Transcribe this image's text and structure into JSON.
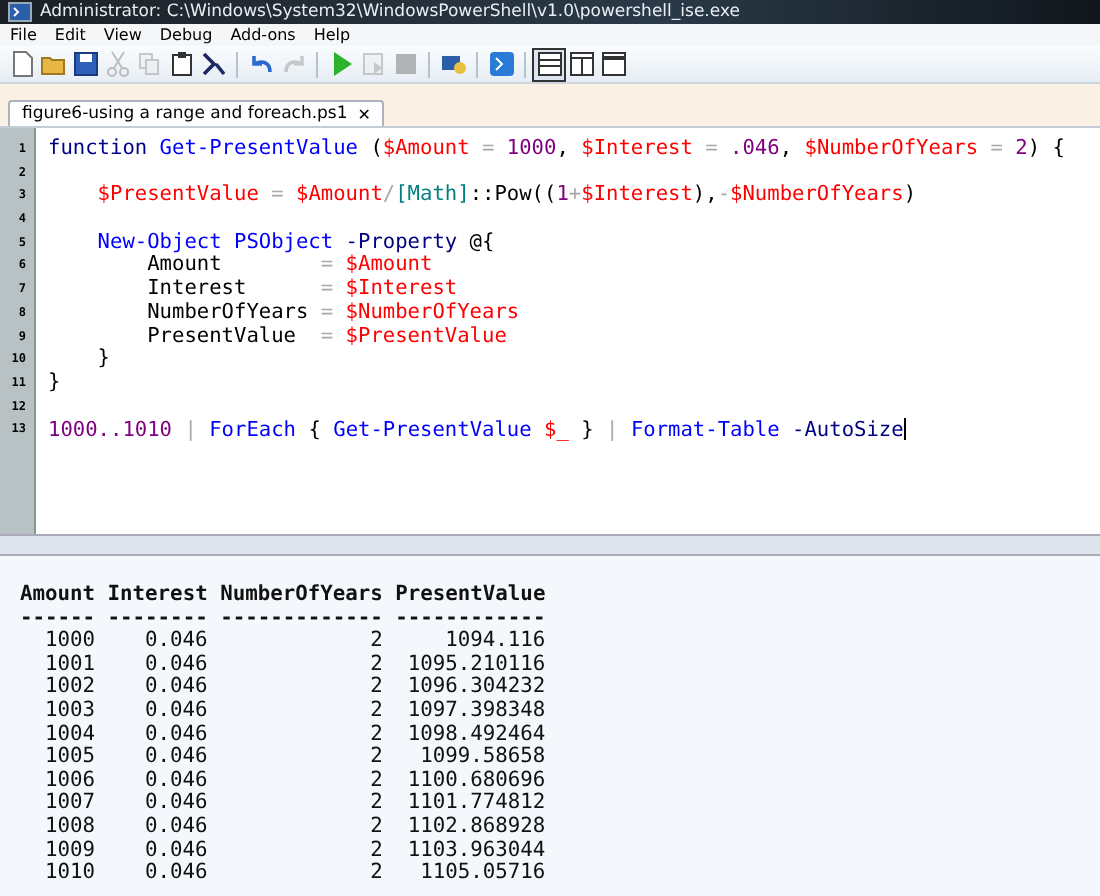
{
  "window": {
    "title": "Administrator: C:\\Windows\\System32\\WindowsPowerShell\\v1.0\\powershell_ise.exe"
  },
  "menu": [
    "File",
    "Edit",
    "View",
    "Debug",
    "Add-ons",
    "Help"
  ],
  "toolbar": [
    {
      "kind": "new",
      "disabled": false
    },
    {
      "kind": "open",
      "disabled": false
    },
    {
      "kind": "save",
      "disabled": false
    },
    {
      "kind": "cut",
      "disabled": true
    },
    {
      "kind": "copy",
      "disabled": true
    },
    {
      "kind": "paste",
      "disabled": false
    },
    {
      "kind": "console",
      "disabled": false
    },
    {
      "kind": "sep"
    },
    {
      "kind": "undo",
      "disabled": false
    },
    {
      "kind": "redo",
      "disabled": true
    },
    {
      "kind": "sep"
    },
    {
      "kind": "run",
      "disabled": false
    },
    {
      "kind": "runsel",
      "disabled": true
    },
    {
      "kind": "stop",
      "disabled": true
    },
    {
      "kind": "sep"
    },
    {
      "kind": "remote",
      "disabled": false
    },
    {
      "kind": "sep"
    },
    {
      "kind": "powershell",
      "disabled": false
    },
    {
      "kind": "sep"
    },
    {
      "kind": "layout-top",
      "selected": true
    },
    {
      "kind": "layout-right",
      "selected": false
    },
    {
      "kind": "layout-max",
      "selected": false
    }
  ],
  "tabs": [
    {
      "label": "figure6-using a range and foreach.ps1",
      "close": "✕",
      "selected": true
    }
  ],
  "editor": {
    "lines": [
      {
        "number": "1",
        "tokens": [
          {
            "text": "function ",
            "kind": "keyword"
          },
          {
            "text": "Get-PresentValue ",
            "kind": "command"
          },
          {
            "text": "(",
            "kind": "plain"
          },
          {
            "text": "$Amount",
            "kind": "variable"
          },
          {
            "text": " = ",
            "kind": "operator"
          },
          {
            "text": "1000",
            "kind": "number"
          },
          {
            "text": ", ",
            "kind": "plain"
          },
          {
            "text": "$Interest",
            "kind": "variable"
          },
          {
            "text": " = ",
            "kind": "operator"
          },
          {
            "text": ".046",
            "kind": "number"
          },
          {
            "text": ", ",
            "kind": "plain"
          },
          {
            "text": "$NumberOfYears",
            "kind": "variable"
          },
          {
            "text": " = ",
            "kind": "operator"
          },
          {
            "text": "2",
            "kind": "number"
          },
          {
            "text": ") {",
            "kind": "plain"
          }
        ]
      },
      {
        "number": "2"
      },
      {
        "number": "3",
        "tokens": [
          {
            "text": "    $PresentValue",
            "kind": "variable"
          },
          {
            "text": " = ",
            "kind": "operator"
          },
          {
            "text": "$Amount",
            "kind": "variable"
          },
          {
            "text": "/",
            "kind": "operator"
          },
          {
            "text": "[Math]",
            "kind": "type"
          },
          {
            "text": "::Pow((",
            "kind": "plain"
          },
          {
            "text": "1",
            "kind": "number"
          },
          {
            "text": "+",
            "kind": "operator"
          },
          {
            "text": "$Interest",
            "kind": "variable"
          },
          {
            "text": "),",
            "kind": "plain"
          },
          {
            "text": "-",
            "kind": "operator"
          },
          {
            "text": "$NumberOfYears",
            "kind": "variable"
          },
          {
            "text": ")",
            "kind": "plain"
          }
        ]
      },
      {
        "number": "4"
      },
      {
        "number": "5",
        "tokens": [
          {
            "text": "    New-Object PSObject ",
            "kind": "command"
          },
          {
            "text": "-Property ",
            "kind": "parameter"
          },
          {
            "text": "@{",
            "kind": "plain"
          }
        ]
      },
      {
        "number": "6",
        "tokens": [
          {
            "text": "        Amount        ",
            "kind": "plain"
          },
          {
            "text": "= ",
            "kind": "operator"
          },
          {
            "text": "$Amount",
            "kind": "variable"
          }
        ]
      },
      {
        "number": "7",
        "tokens": [
          {
            "text": "        Interest      ",
            "kind": "plain"
          },
          {
            "text": "= ",
            "kind": "operator"
          },
          {
            "text": "$Interest",
            "kind": "variable"
          }
        ]
      },
      {
        "number": "8",
        "tokens": [
          {
            "text": "        NumberOfYears ",
            "kind": "plain"
          },
          {
            "text": "= ",
            "kind": "operator"
          },
          {
            "text": "$NumberOfYears",
            "kind": "variable"
          }
        ]
      },
      {
        "number": "9",
        "tokens": [
          {
            "text": "        PresentValue  ",
            "kind": "plain"
          },
          {
            "text": "= ",
            "kind": "operator"
          },
          {
            "text": "$PresentValue",
            "kind": "variable"
          }
        ]
      },
      {
        "number": "10",
        "tokens": [
          {
            "text": "    }",
            "kind": "plain"
          }
        ]
      },
      {
        "number": "11",
        "tokens": [
          {
            "text": "}",
            "kind": "plain"
          }
        ]
      },
      {
        "number": "12"
      },
      {
        "number": "13",
        "tokens": [
          {
            "text": "1000..1010",
            "kind": "number"
          },
          {
            "text": " | ",
            "kind": "operator"
          },
          {
            "text": "ForEach ",
            "kind": "command"
          },
          {
            "text": "{ ",
            "kind": "plain"
          },
          {
            "text": "Get-PresentValue ",
            "kind": "command"
          },
          {
            "text": "$_",
            "kind": "variable"
          },
          {
            "text": " } ",
            "kind": "plain"
          },
          {
            "text": "| ",
            "kind": "operator"
          },
          {
            "text": "Format-Table ",
            "kind": "command"
          },
          {
            "text": "-AutoSize",
            "kind": "parameter"
          }
        ],
        "cursor": true
      }
    ]
  },
  "output": {
    "columns": [
      {
        "label": "Amount",
        "rule": "------"
      },
      {
        "label": "Interest",
        "rule": "--------"
      },
      {
        "label": "NumberOfYears",
        "rule": "-------------"
      },
      {
        "label": "PresentValue",
        "rule": "------------"
      }
    ],
    "rows": [
      [
        "1000",
        "0.046",
        "2",
        "1094.116"
      ],
      [
        "1001",
        "0.046",
        "2",
        "1095.210116"
      ],
      [
        "1002",
        "0.046",
        "2",
        "1096.304232"
      ],
      [
        "1003",
        "0.046",
        "2",
        "1097.398348"
      ],
      [
        "1004",
        "0.046",
        "2",
        "1098.492464"
      ],
      [
        "1005",
        "0.046",
        "2",
        "1099.58658"
      ],
      [
        "1006",
        "0.046",
        "2",
        "1100.680696"
      ],
      [
        "1007",
        "0.046",
        "2",
        "1101.774812"
      ],
      [
        "1008",
        "0.046",
        "2",
        "1102.868928"
      ],
      [
        "1009",
        "0.046",
        "2",
        "1103.963044"
      ],
      [
        "1010",
        "0.046",
        "2",
        "1105.05716"
      ]
    ]
  }
}
